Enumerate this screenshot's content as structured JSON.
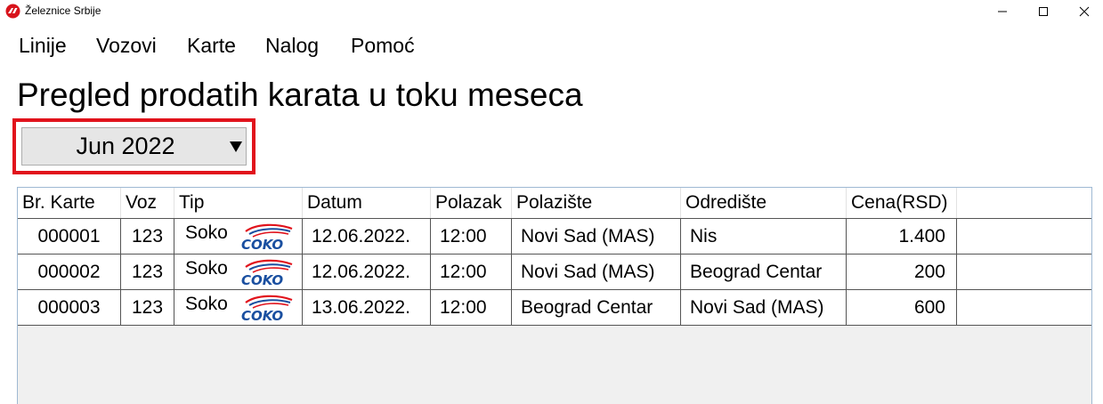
{
  "window": {
    "title": "Železnice Srbije"
  },
  "menu": {
    "items": [
      "Linije",
      "Vozovi",
      "Karte",
      "Nalog",
      "Pomoć"
    ]
  },
  "page": {
    "title": "Pregled prodatih karata u toku meseca"
  },
  "month_select": {
    "value": "Jun 2022",
    "arrow": "▼"
  },
  "colors": {
    "highlight_border": "#e1131c",
    "logo_blue": "#1a4fa0",
    "logo_red": "#e1131c"
  },
  "table": {
    "columns": [
      "Br. Karte",
      "Voz",
      "Tip",
      "Datum",
      "Polazak",
      "Polazište",
      "Odredište",
      "Cena(RSD)"
    ],
    "rows": [
      {
        "br_karte": "000001",
        "voz": "123",
        "tip": "Soko",
        "tip_logo": "COKO",
        "datum": "12.06.2022.",
        "polazak": "12:00",
        "polaziste": "Novi Sad (MAS)",
        "odrediste": "Nis",
        "cena": "1.400"
      },
      {
        "br_karte": "000002",
        "voz": "123",
        "tip": "Soko",
        "tip_logo": "COKO",
        "datum": "12.06.2022.",
        "polazak": "12:00",
        "polaziste": "Novi Sad (MAS)",
        "odrediste": "Beograd Centar",
        "cena": "200"
      },
      {
        "br_karte": "000003",
        "voz": "123",
        "tip": "Soko",
        "tip_logo": "COKO",
        "datum": "13.06.2022.",
        "polazak": "12:00",
        "polaziste": "Beograd Centar",
        "odrediste": "Novi Sad (MAS)",
        "cena": "600"
      }
    ]
  }
}
